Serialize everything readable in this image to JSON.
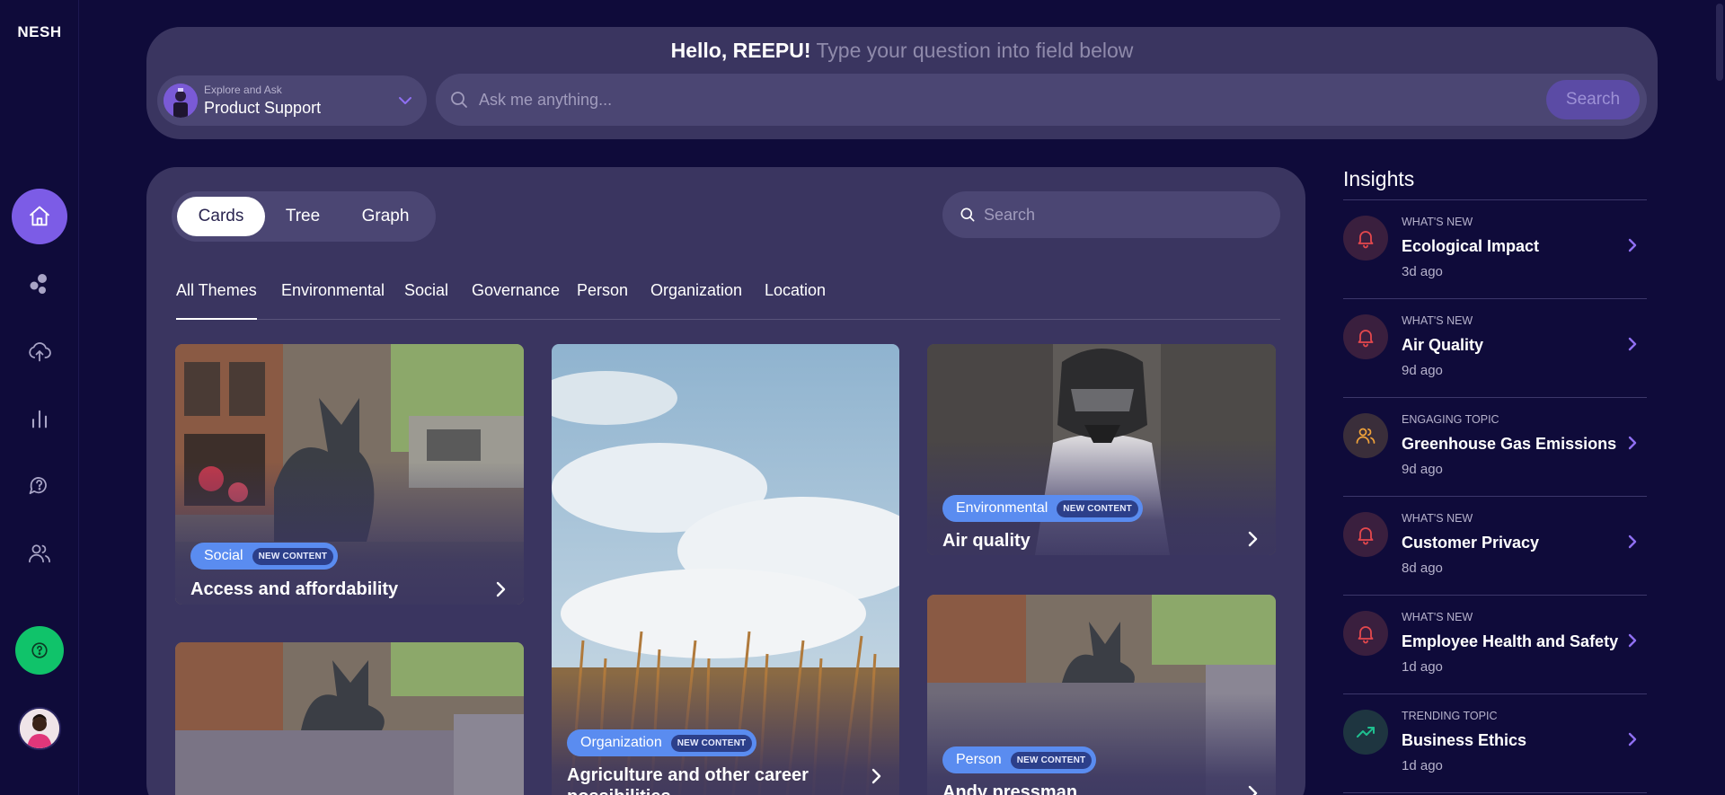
{
  "app": {
    "logo": "NESH"
  },
  "sidebar": {
    "items": [
      {
        "name": "home",
        "icon": "home-icon",
        "active": true
      },
      {
        "name": "explore",
        "icon": "bubbles-icon"
      },
      {
        "name": "upload",
        "icon": "cloud-upload-icon"
      },
      {
        "name": "analytics",
        "icon": "bar-chart-icon"
      },
      {
        "name": "questions",
        "icon": "chat-question-icon"
      },
      {
        "name": "users",
        "icon": "users-icon"
      }
    ],
    "help_icon": "help-circle-icon",
    "accent": "#7c5ce6",
    "help_color": "#10c36a"
  },
  "header": {
    "hello": "Hello, REEPU!",
    "prompt": " Type your question into field below",
    "assistant_caption": "Explore and Ask",
    "assistant_name": "Product Support",
    "ask_placeholder": "Ask me anything...",
    "search_label": "Search"
  },
  "main": {
    "views": [
      "Cards",
      "Tree",
      "Graph"
    ],
    "active_view": "Cards",
    "search_placeholder": "Search",
    "themes": [
      "All Themes",
      "Environmental",
      "Social",
      "Governance",
      "Person",
      "Organization",
      "Location"
    ],
    "active_theme": "All Themes",
    "cards": [
      {
        "tag": "Social",
        "badge": "NEW CONTENT",
        "title": "Access and affordability"
      },
      {
        "tag": "Organization",
        "badge": "NEW CONTENT",
        "title": "Agriculture and other career possibilities"
      },
      {
        "tag": "Environmental",
        "badge": "NEW CONTENT",
        "title": "Air quality"
      },
      {
        "tag": "Person",
        "badge": "NEW CONTENT",
        "title": "Andy pressman"
      },
      {
        "tag": "",
        "badge": "",
        "title": ""
      }
    ]
  },
  "insights": {
    "title": "Insights",
    "items": [
      {
        "kind": "WHAT'S NEW",
        "name": "Ecological Impact",
        "time": "3d ago",
        "icon": "bell-icon",
        "color": "#e5484d"
      },
      {
        "kind": "WHAT'S NEW",
        "name": "Air Quality",
        "time": "9d ago",
        "icon": "bell-icon",
        "color": "#e5484d"
      },
      {
        "kind": "ENGAGING TOPIC",
        "name": "Greenhouse Gas Emissions",
        "time": "9d ago",
        "icon": "users-icon",
        "color": "#f0a23a"
      },
      {
        "kind": "WHAT'S NEW",
        "name": "Customer Privacy",
        "time": "8d ago",
        "icon": "bell-icon",
        "color": "#e5484d"
      },
      {
        "kind": "WHAT'S NEW",
        "name": "Employee Health and Safety",
        "time": "1d ago",
        "icon": "bell-icon",
        "color": "#e5484d"
      },
      {
        "kind": "TRENDING TOPIC",
        "name": "Business Ethics",
        "time": "1d ago",
        "icon": "trending-up-icon",
        "color": "#1fbf8f"
      }
    ]
  }
}
